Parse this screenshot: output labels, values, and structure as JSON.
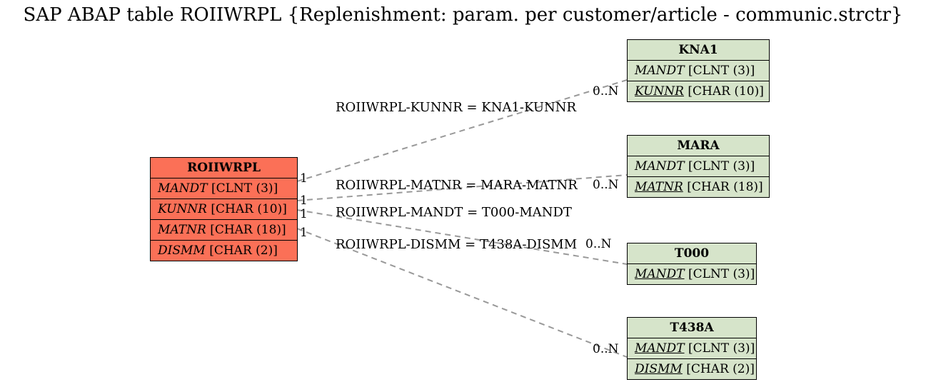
{
  "title": "SAP ABAP table ROIIWRPL {Replenishment: param. per customer/article - communic.strctr}",
  "main_table": {
    "name": "ROIIWRPL",
    "fields": [
      {
        "name": "MANDT",
        "type": "[CLNT (3)]",
        "underline": false
      },
      {
        "name": "KUNNR",
        "type": "[CHAR (10)]",
        "underline": false
      },
      {
        "name": "MATNR",
        "type": "[CHAR (18)]",
        "underline": false
      },
      {
        "name": "DISMM",
        "type": "[CHAR (2)]",
        "underline": false
      }
    ]
  },
  "ref_tables": [
    {
      "name": "KNA1",
      "fields": [
        {
          "name": "MANDT",
          "type": "[CLNT (3)]",
          "underline": false
        },
        {
          "name": "KUNNR",
          "type": "[CHAR (10)]",
          "underline": true
        }
      ]
    },
    {
      "name": "MARA",
      "fields": [
        {
          "name": "MANDT",
          "type": "[CLNT (3)]",
          "underline": false
        },
        {
          "name": "MATNR",
          "type": "[CHAR (18)]",
          "underline": true
        }
      ]
    },
    {
      "name": "T000",
      "fields": [
        {
          "name": "MANDT",
          "type": "[CLNT (3)]",
          "underline": true
        }
      ]
    },
    {
      "name": "T438A",
      "fields": [
        {
          "name": "MANDT",
          "type": "[CLNT (3)]",
          "underline": true
        },
        {
          "name": "DISMM",
          "type": "[CHAR (2)]",
          "underline": true
        }
      ]
    }
  ],
  "relations": [
    {
      "label": "ROIIWRPL-KUNNR = KNA1-KUNNR",
      "card_left": "1",
      "card_right": "0..N"
    },
    {
      "label": "ROIIWRPL-MATNR = MARA-MATNR",
      "card_left": "1",
      "card_right": "0..N"
    },
    {
      "label": "ROIIWRPL-MANDT = T000-MANDT",
      "card_left": "1",
      "card_right": ""
    },
    {
      "label": "ROIIWRPL-DISMM = T438A-DISMM",
      "card_left": "1",
      "card_right": "0..N"
    }
  ]
}
